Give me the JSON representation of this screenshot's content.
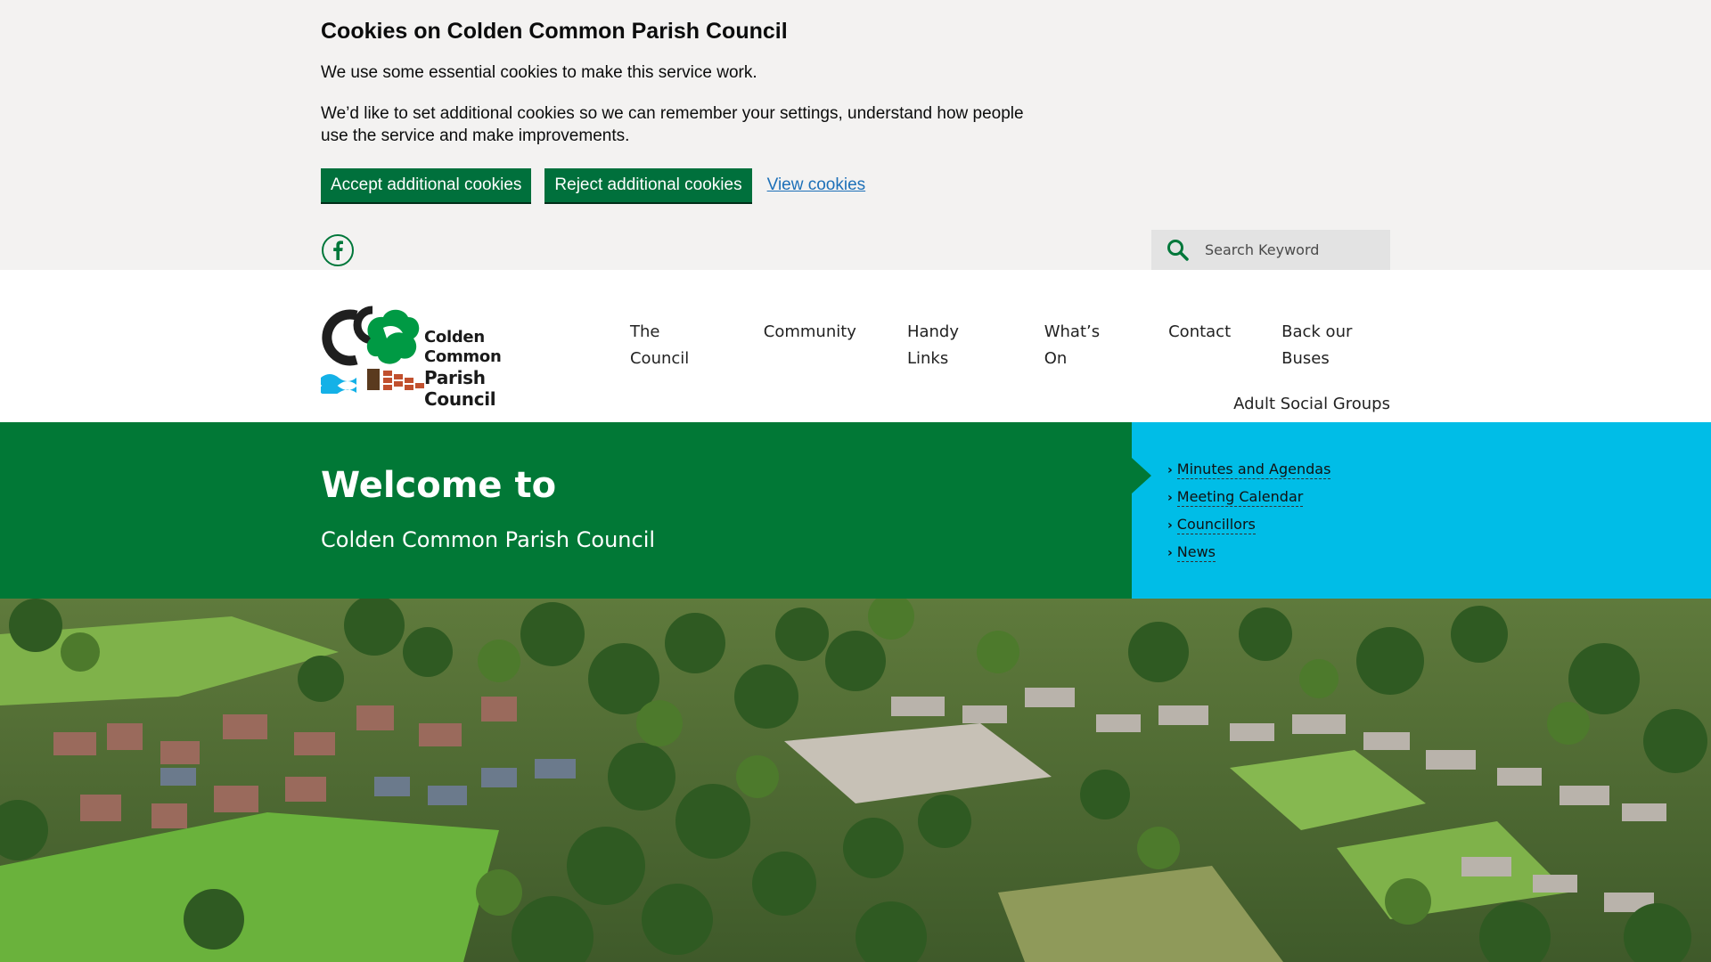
{
  "cookie_banner": {
    "title": "Cookies on Colden Common Parish Council",
    "paragraph1": "We use some essential cookies to make this service work.",
    "paragraph2": "We’d like to set additional cookies so we can remember your settings, understand how people use the service and make improvements.",
    "accept_label": "Accept additional cookies",
    "reject_label": "Reject additional cookies",
    "view_label": "View cookies"
  },
  "utility_bar": {
    "social_icon": "facebook-icon",
    "search_placeholder": "Search Keyword"
  },
  "header": {
    "logo_line1": "Colden Common",
    "logo_line2": "Parish Council",
    "nav_row1": [
      "The Council",
      "Community",
      "Handy Links",
      "What’s On",
      "Contact",
      "Back our Buses"
    ],
    "nav_row2": [
      "Adult Social Groups"
    ]
  },
  "hero": {
    "title": "Welcome to",
    "subtitle": "Colden Common Parish Council",
    "quick_links": [
      "Minutes and Agendas",
      "Meeting Calendar",
      "Councillors",
      "News"
    ]
  },
  "colors": {
    "brand_green": "#017836",
    "button_green": "#00703c",
    "accent_cyan": "#00bde7",
    "link_blue": "#1d70b8",
    "banner_grey": "#f3f2f1"
  }
}
